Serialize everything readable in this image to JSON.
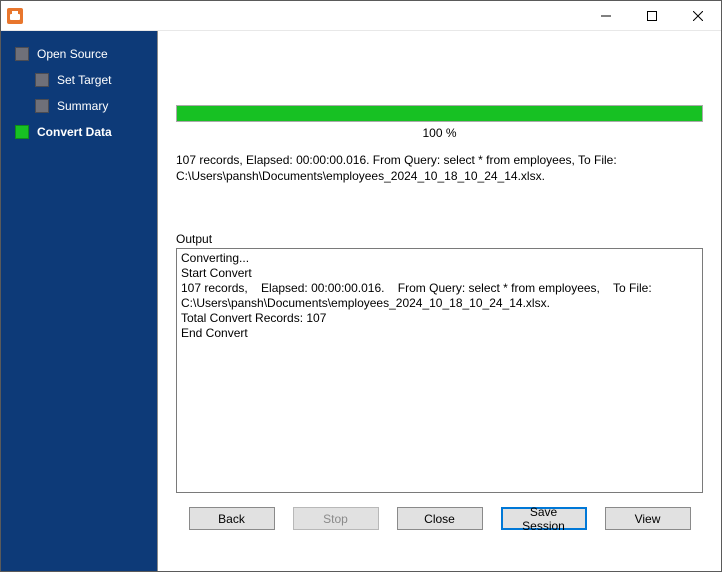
{
  "sidebar": {
    "items": [
      {
        "label": "Open Source",
        "level": 0,
        "active": false
      },
      {
        "label": "Set Target",
        "level": 1,
        "active": false
      },
      {
        "label": "Summary",
        "level": 1,
        "active": false
      },
      {
        "label": "Convert Data",
        "level": 0,
        "active": true
      }
    ]
  },
  "progress": {
    "percent": 100,
    "percent_label": "100 %"
  },
  "summary_text": "107 records,    Elapsed: 00:00:00.016.    From Query: select * from employees,    To File: C:\\Users\\pansh\\Documents\\employees_2024_10_18_10_24_14.xlsx.",
  "output": {
    "label": "Output",
    "lines": [
      "Converting...",
      "Start Convert",
      "107 records,    Elapsed: 00:00:00.016.    From Query: select * from employees,    To File: C:\\Users\\pansh\\Documents\\employees_2024_10_18_10_24_14.xlsx.",
      "Total Convert Records: 107",
      "End Convert"
    ]
  },
  "buttons": {
    "back": "Back",
    "stop": "Stop",
    "close": "Close",
    "save_session": "Save Session",
    "view": "View"
  },
  "colors": {
    "sidebar_bg": "#0d3a78",
    "progress_fill": "#17c123",
    "focus_border": "#0078d7"
  }
}
